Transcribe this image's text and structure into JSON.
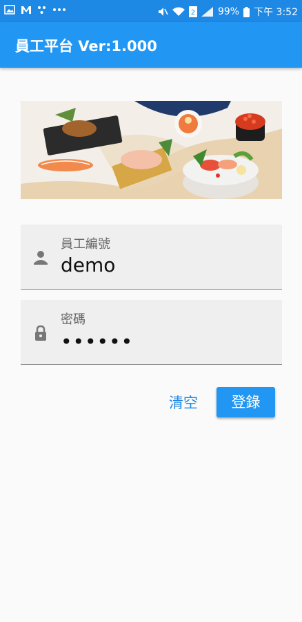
{
  "status_bar": {
    "icons_left": [
      "image-icon",
      "mail-icon",
      "dots-icon",
      "more-icon"
    ],
    "battery": "99%",
    "time": "下午 3:52",
    "sim_badge": "2"
  },
  "appbar": {
    "title": "員工平台 Ver:1.000"
  },
  "banner": {
    "description_icon": "sushi-banner-image"
  },
  "form": {
    "employee_id": {
      "label": "員工編號",
      "value": "demo"
    },
    "password": {
      "label": "密碼",
      "value": "••••••"
    }
  },
  "actions": {
    "clear_label": "清空",
    "login_label": "登錄"
  },
  "colors": {
    "primary": "#2196f3",
    "status": "#1e88e5",
    "field_bg": "#efefef"
  }
}
